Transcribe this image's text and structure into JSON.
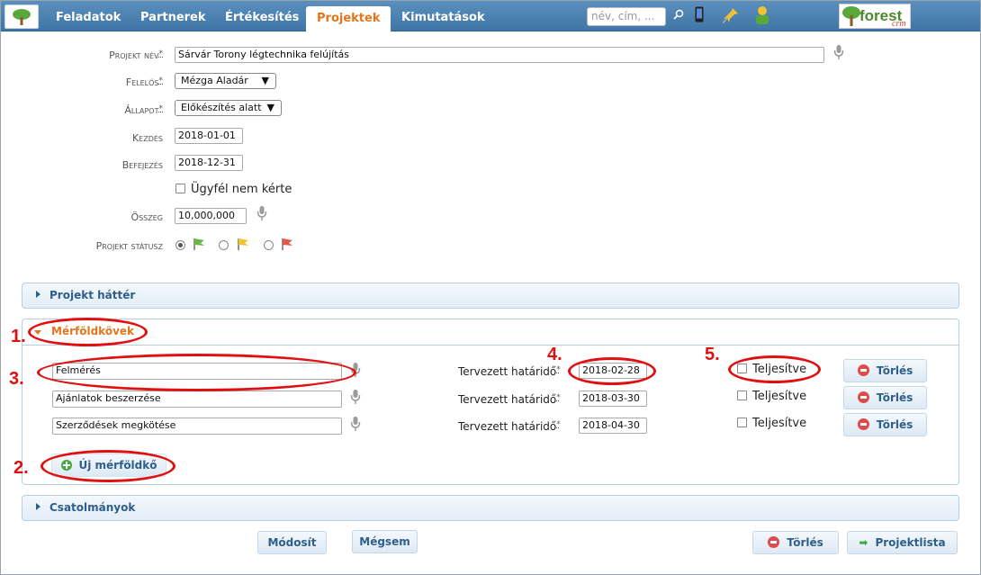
{
  "nav": {
    "tabs": [
      "Feladatok",
      "Partnerek",
      "Értékesítés",
      "Projektek",
      "Kimutatások"
    ],
    "active_tab": "Projektek",
    "search_placeholder": "név, cím, ...",
    "brand_text": "forest",
    "brand_sub": "crm"
  },
  "form": {
    "project_name_label": "Projekt név",
    "project_name_value": "Sárvár Torony légtechnika felújítás",
    "owner_label": "Felelős",
    "owner_value": "Mézga Aladár",
    "state_label": "Állapot",
    "state_value": "Előkészítés alatt",
    "start_label": "Kezdés",
    "start_value": "2018-01-01",
    "end_label": "Befejezés",
    "end_value": "2018-12-31",
    "client_not_asked_label": "Ügyfél nem kérte",
    "amount_label": "Összeg",
    "amount_value": "10,000,000",
    "status_label": "Projekt státusz",
    "req_mark": "*"
  },
  "sections": {
    "background_title": "Projekt háttér",
    "milestones_title": "Mérföldkövek",
    "attachments_title": "Csatolmányok"
  },
  "milestones": [
    {
      "name": "Felmérés",
      "deadline_label": "Tervezett határidő",
      "deadline": "2018-02-28",
      "done_label": "Teljesítve",
      "delete_label": "Törlés"
    },
    {
      "name": "Ajánlatok beszerzése",
      "deadline_label": "Tervezett határidő",
      "deadline": "2018-03-30",
      "done_label": "Teljesítve",
      "delete_label": "Törlés"
    },
    {
      "name": "Szerződések megkötése",
      "deadline_label": "Tervezett határidő",
      "deadline": "2018-04-30",
      "done_label": "Teljesítve",
      "delete_label": "Törlés"
    }
  ],
  "new_milestone_label": "Új mérföldkő",
  "footer": {
    "modify_label": "Módosít",
    "cancel_label": "Mégsem",
    "delete_label": "Törlés",
    "list_label": "Projektlista"
  },
  "annotations": [
    "1.",
    "2.",
    "3.",
    "4.",
    "5."
  ],
  "colors": {
    "nav": "#3f76a6",
    "accent": "#e2761d",
    "annotation": "#e01010"
  }
}
